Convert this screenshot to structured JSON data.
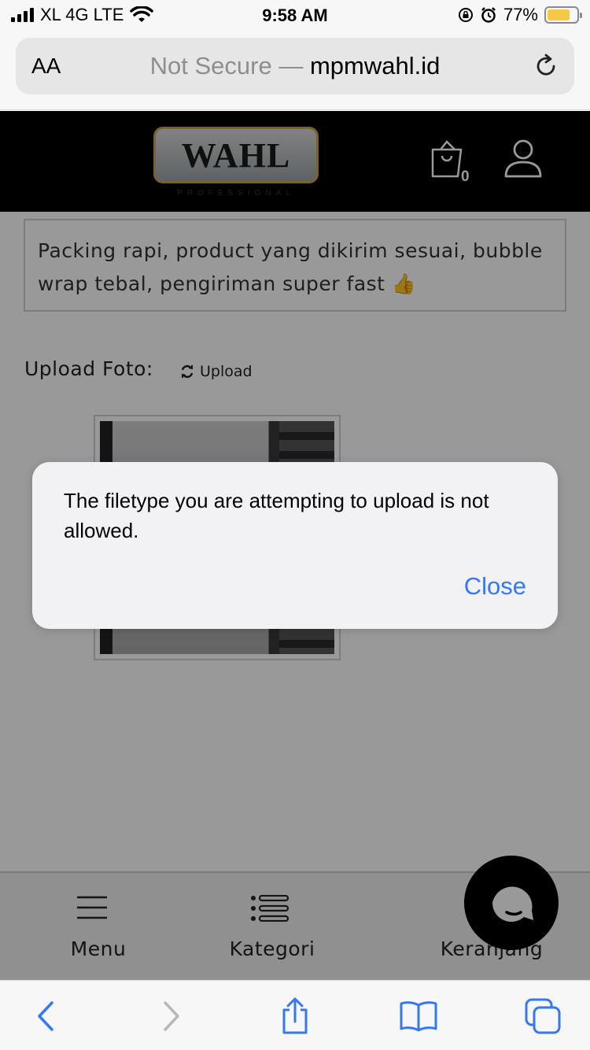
{
  "status_bar": {
    "carrier": "XL 4G LTE",
    "time": "9:58 AM",
    "battery": "77%",
    "battery_level": 0.77
  },
  "browser": {
    "text_size_label": "AA",
    "security_label": "Not Secure —",
    "domain": "mpmwahl.id"
  },
  "header": {
    "logo_text": "WAHL",
    "logo_subtext": "PROFESSIONAL",
    "cart_count": "0"
  },
  "content": {
    "review_text": "Packing rapi, product yang dikirim sesuai, bubble wrap tebal, pengiriman super fast 👍",
    "upload_label": "Upload Foto:",
    "upload_button": "Upload"
  },
  "bottom_nav": {
    "items": [
      {
        "label": "Menu",
        "icon": "hamburger-icon"
      },
      {
        "label": "Kategori",
        "icon": "list-icon"
      },
      {
        "label": "Keranjang",
        "icon": "cart-icon"
      }
    ]
  },
  "alert": {
    "message": "The filetype you are attempting to upload is not allowed.",
    "close_label": "Close"
  },
  "colors": {
    "link_blue": "#3478f6",
    "battery_yellow": "#f6c844",
    "header_black": "#000000"
  }
}
